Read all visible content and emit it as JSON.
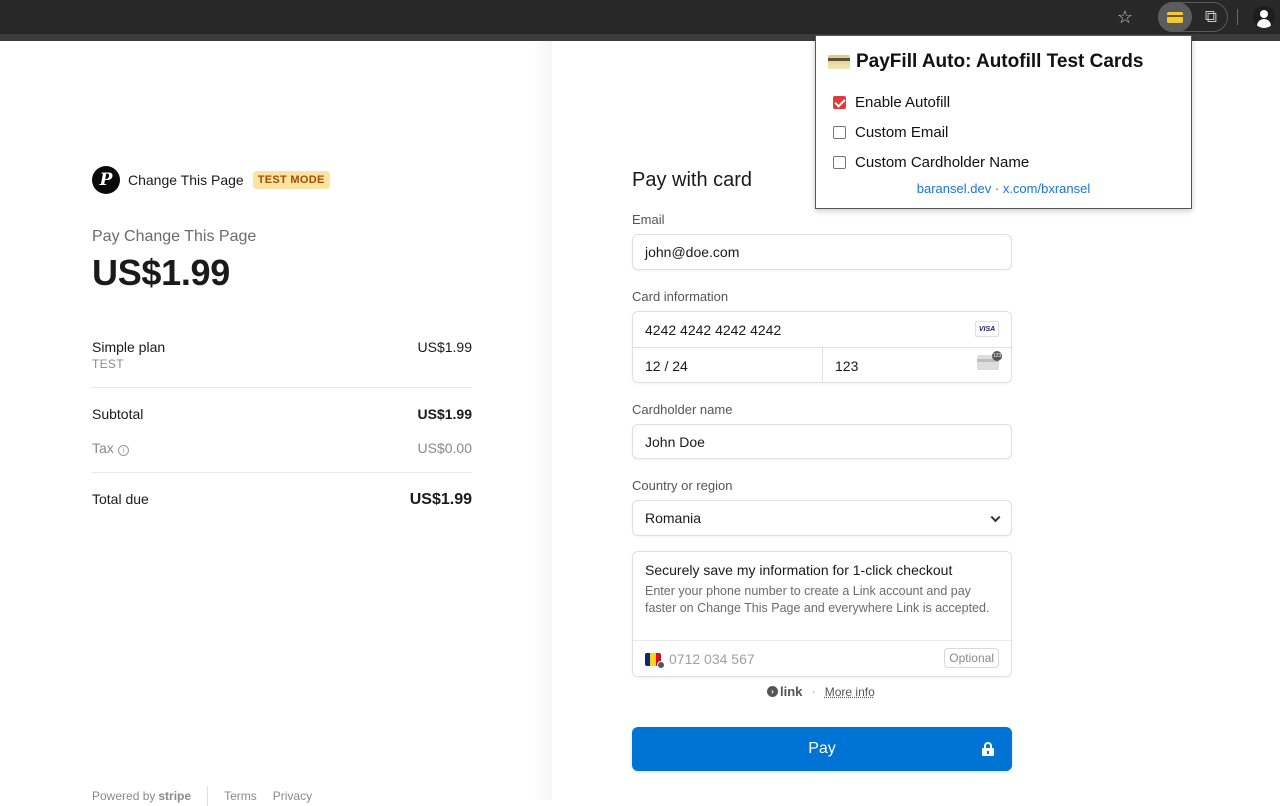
{
  "browser": {
    "toolbar_icons": [
      "star-icon",
      "payfill-extension-icon",
      "extensions-puzzle-icon",
      "profile-icon"
    ],
    "star_glyph": "☆",
    "puzzle_glyph": "⧉"
  },
  "extension_popup": {
    "title": "PayFill Auto: Autofill Test Cards",
    "options": [
      {
        "label": "Enable Autofill",
        "checked": true
      },
      {
        "label": "Custom Email",
        "checked": false
      },
      {
        "label": "Custom Cardholder Name",
        "checked": false
      }
    ],
    "links": [
      {
        "label": "baransel.dev"
      },
      {
        "label": "x.com/bxransel"
      }
    ],
    "link_separator": "·",
    "accent_color": "#e03a3a"
  },
  "summary": {
    "merchant_logo_letter": "P",
    "merchant_name": "Change This Page",
    "test_badge": "TEST MODE",
    "pay_label": "Pay Change This Page",
    "pay_amount": "US$1.99",
    "line_items": [
      {
        "name": "Simple plan",
        "sub": "TEST",
        "price": "US$1.99"
      }
    ],
    "subtotal_label": "Subtotal",
    "subtotal_value": "US$1.99",
    "tax_label": "Tax",
    "tax_value": "US$0.00",
    "total_label": "Total due",
    "total_value": "US$1.99"
  },
  "footer": {
    "powered_by": "Powered by",
    "brand": "stripe",
    "terms": "Terms",
    "privacy": "Privacy"
  },
  "form": {
    "title": "Pay with card",
    "email_label": "Email",
    "email_value": "john@doe.com",
    "card_label": "Card information",
    "card_number": "4242 4242 4242 4242",
    "card_brand": "VISA",
    "expiry": "12 / 24",
    "cvc": "123",
    "cardholder_label": "Cardholder name",
    "cardholder_value": "John Doe",
    "country_label": "Country or region",
    "country_value": "Romania",
    "link_title": "Securely save my information for 1-click checkout",
    "link_desc": "Enter your phone number to create a Link account and pay faster on Change This Page and everywhere Link is accepted.",
    "phone_placeholder": "0712 034 567",
    "optional_label": "Optional",
    "link_brand": "link",
    "link_dot": "·",
    "more_info": "More info",
    "pay_button": "Pay",
    "pay_button_color": "#0074d4"
  }
}
